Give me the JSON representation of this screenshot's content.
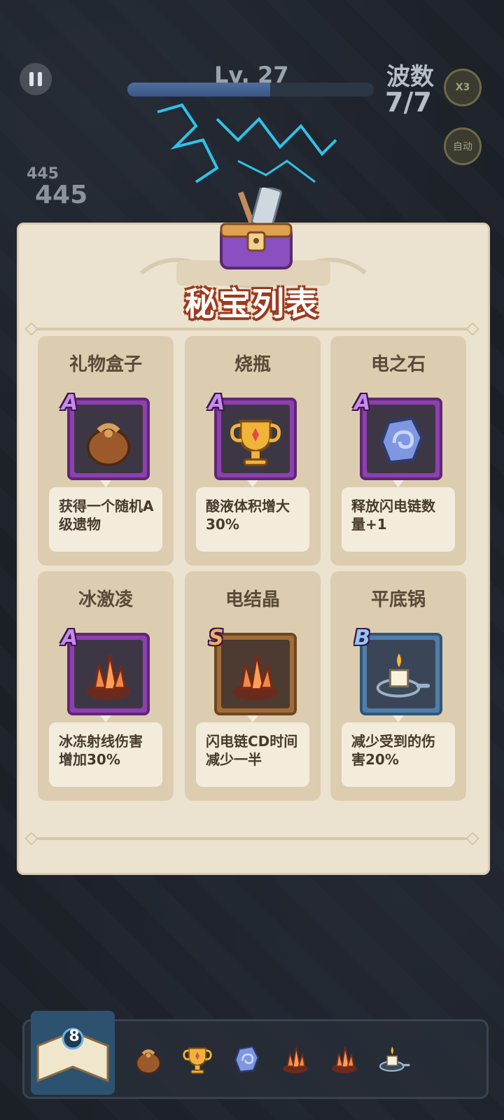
{
  "hud": {
    "level_label": "Lv. 27",
    "level_progress": 0.58,
    "wave_label": "波数",
    "wave_value": "7/7",
    "speed_label": "X3",
    "auto_label": "自动",
    "damage_small": "445",
    "damage_large": "445"
  },
  "panel": {
    "title": "秘宝列表",
    "items": [
      {
        "name": "礼物盒子",
        "grade": "A",
        "icon": "loot-bag-icon",
        "desc": "获得一个随机A级遗物"
      },
      {
        "name": "烧瓶",
        "grade": "A",
        "icon": "trophy-cup-icon",
        "desc": "酸液体积增大30%"
      },
      {
        "name": "电之石",
        "grade": "A",
        "icon": "rune-stone-icon",
        "desc": "释放闪电链数量+1"
      },
      {
        "name": "冰激凌",
        "grade": "A",
        "icon": "crystal-cluster-icon",
        "desc": "冰冻射线伤害增加30%"
      },
      {
        "name": "电结晶",
        "grade": "S",
        "icon": "crystal-cluster-icon",
        "desc": "闪电链CD时间减少一半"
      },
      {
        "name": "平底锅",
        "grade": "B",
        "icon": "candle-pan-icon",
        "desc": "减少受到的伤害20%"
      }
    ]
  },
  "bottom_bar": {
    "book_count": "8",
    "slots": [
      "loot-bag-icon",
      "trophy-cup-icon",
      "rune-stone-icon",
      "crystal-cluster-icon",
      "crystal-cluster-icon",
      "candle-pan-icon"
    ]
  },
  "colors": {
    "grade_a": "#8e3fb0",
    "grade_s": "#a26c36",
    "grade_b": "#4f7fa8",
    "title_outline": "#9c3a1e",
    "panel": "#ebe2cf"
  }
}
